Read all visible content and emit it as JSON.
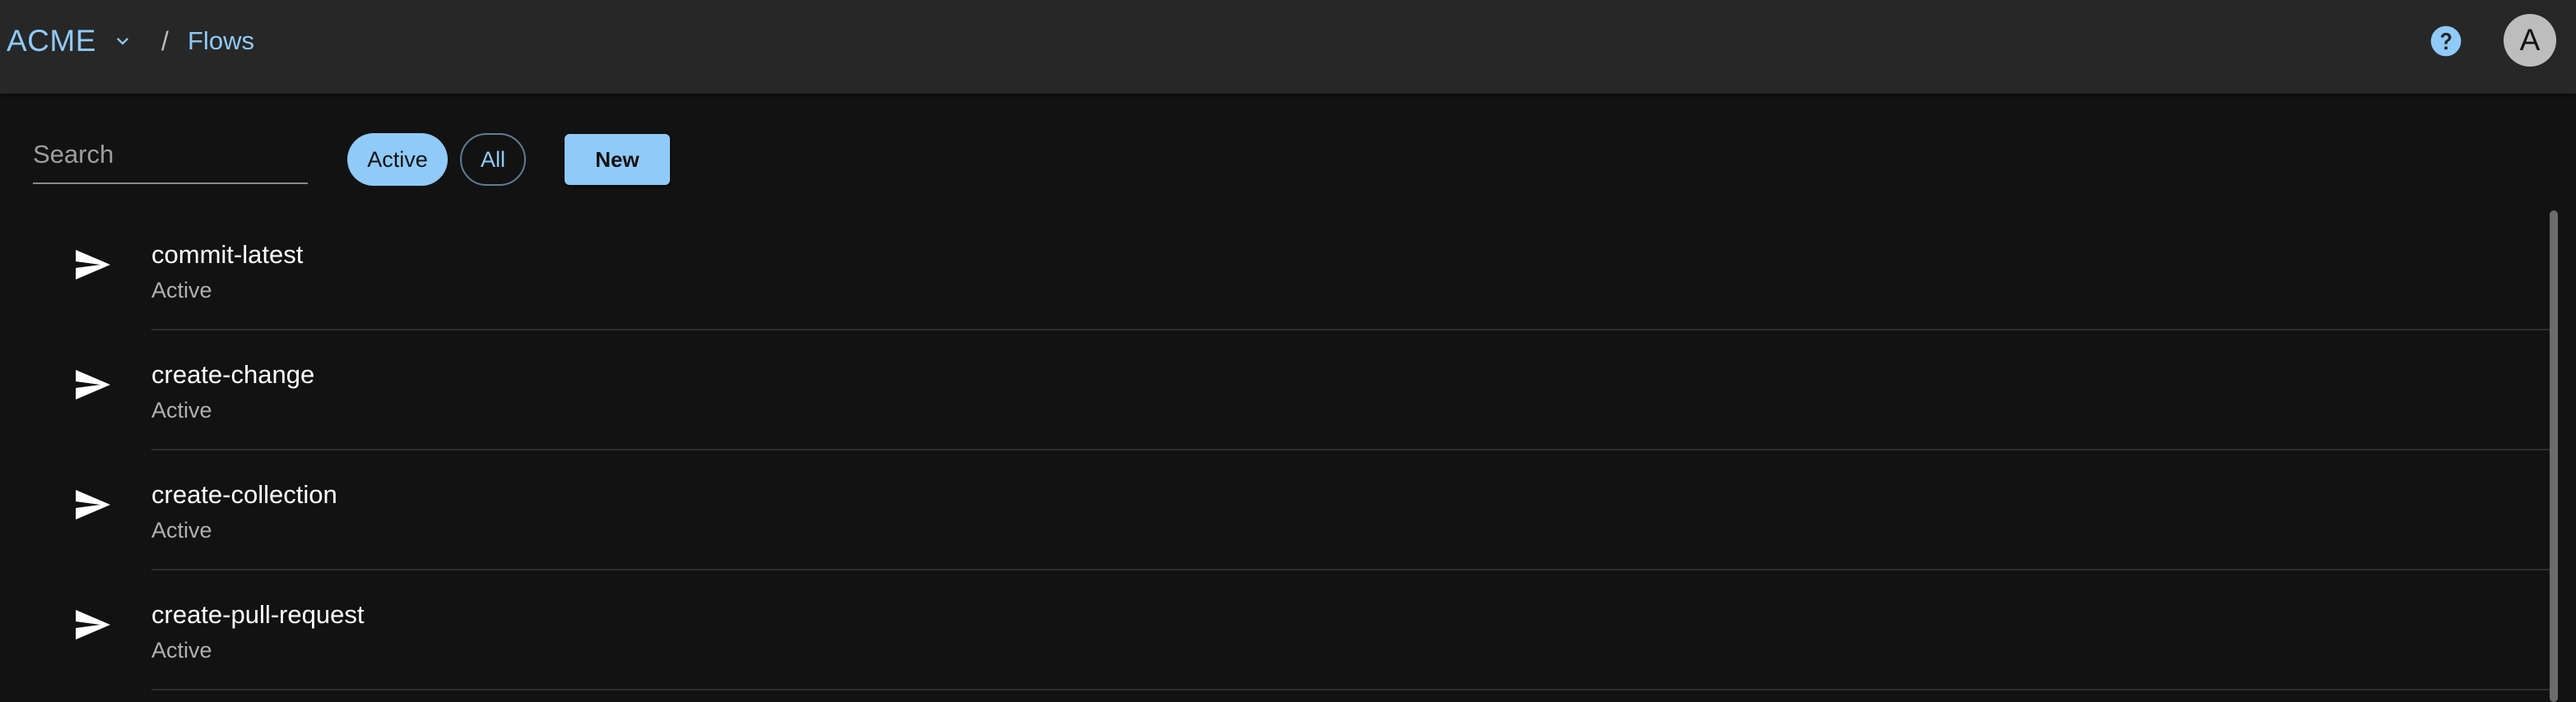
{
  "header": {
    "org_name": "ACME",
    "breadcrumb_separator": "/",
    "breadcrumb_current": "Flows",
    "avatar_initial": "A",
    "icons": {
      "org_menu": "chevron-down-icon",
      "help": "help-circle-icon"
    }
  },
  "toolbar": {
    "search_placeholder": "Search",
    "search_value": "",
    "filter_active_label": "Active",
    "filter_all_label": "All",
    "new_label": "New"
  },
  "flows": [
    {
      "name": "commit-latest",
      "status": "Active",
      "icon": "send-icon"
    },
    {
      "name": "create-change",
      "status": "Active",
      "icon": "send-icon"
    },
    {
      "name": "create-collection",
      "status": "Active",
      "icon": "send-icon"
    },
    {
      "name": "create-pull-request",
      "status": "Active",
      "icon": "send-icon"
    }
  ],
  "colors": {
    "accent": "#90caf9",
    "topbar_bg": "#272727",
    "page_bg": "#121212",
    "divider": "#2e2e2e",
    "secondary_text": "#b0b0b0"
  }
}
